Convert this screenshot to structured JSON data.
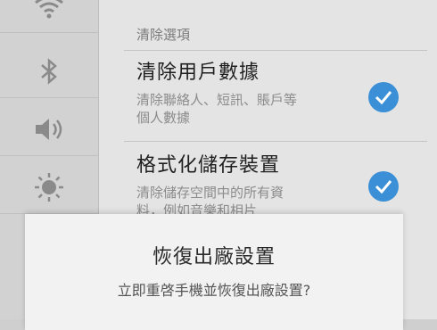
{
  "sidebar": {
    "items": [
      {
        "icon": "wifi-icon"
      },
      {
        "icon": "bluetooth-icon"
      },
      {
        "icon": "volume-icon"
      },
      {
        "icon": "brightness-icon"
      }
    ]
  },
  "main": {
    "section_header": "清除選項",
    "options": [
      {
        "title": "清除用戶數據",
        "description_line1": "清除聯絡人、短訊、賬戶等",
        "description_line2": "個人數據",
        "checked": true
      },
      {
        "title": "格式化儲存裝置",
        "description_line1": "清除儲存空間中的所有資",
        "description_line2": "料，例如音樂和相片",
        "checked": true
      }
    ]
  },
  "dialog": {
    "title": "恢復出廠設置",
    "message": "立即重啓手機並恢復出廠設置?"
  },
  "colors": {
    "accent": "#3a8fd6",
    "background": "#e4e4e4",
    "sidebar": "#d2d2d2"
  }
}
